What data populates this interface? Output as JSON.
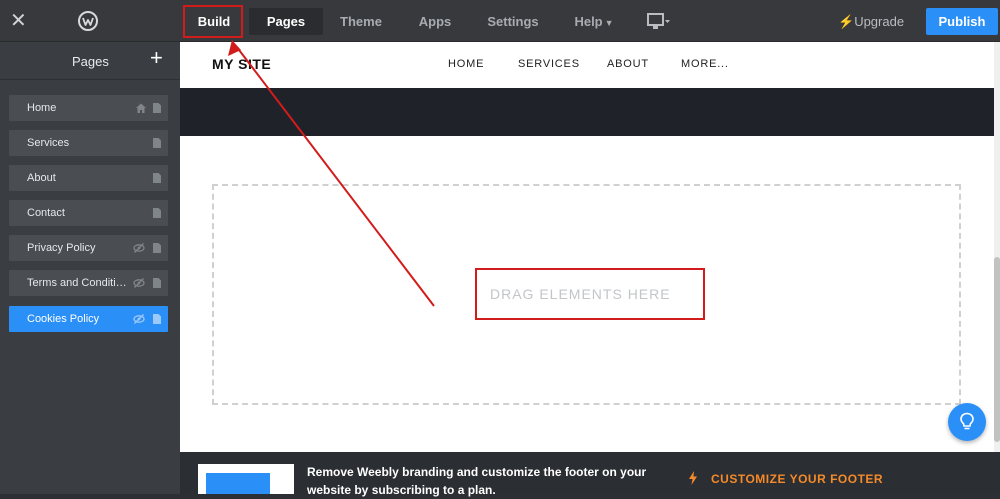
{
  "topbar": {
    "tabs": [
      {
        "label": "Build"
      },
      {
        "label": "Pages"
      },
      {
        "label": "Theme"
      },
      {
        "label": "Apps"
      },
      {
        "label": "Settings"
      },
      {
        "label": "Help"
      }
    ],
    "upgrade_label": "Upgrade",
    "publish_label": "Publish"
  },
  "sidebar": {
    "title": "Pages",
    "items": [
      {
        "label": "Home"
      },
      {
        "label": "Services"
      },
      {
        "label": "About"
      },
      {
        "label": "Contact"
      },
      {
        "label": "Privacy Policy"
      },
      {
        "label": "Terms and Conditions"
      },
      {
        "label": "Cookies Policy"
      }
    ]
  },
  "site": {
    "title": "MY SITE",
    "nav": [
      {
        "label": "HOME"
      },
      {
        "label": "SERVICES"
      },
      {
        "label": "ABOUT"
      },
      {
        "label": "MORE..."
      }
    ],
    "drop_text": "DRAG ELEMENTS HERE"
  },
  "footer": {
    "message": "Remove Weebly branding and customize the footer on your website by subscribing to a plan.",
    "cta": "CUSTOMIZE YOUR FOOTER"
  },
  "colors": {
    "accent": "#2a8ff7",
    "highlight": "#d21c1c",
    "cta": "#f58a2a"
  }
}
